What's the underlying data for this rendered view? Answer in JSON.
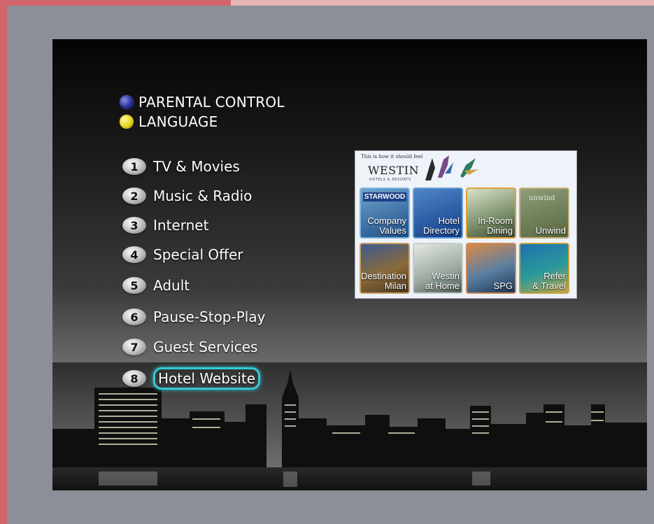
{
  "color_options": [
    {
      "label": "PARENTAL CONTROL",
      "color": "#2b2f9c",
      "icon": "blue-button-icon"
    },
    {
      "label": "LANGUAGE",
      "color": "#e6d21a",
      "icon": "yellow-button-icon"
    }
  ],
  "menu": [
    {
      "number": "1",
      "label": "TV & Movies"
    },
    {
      "number": "2",
      "label": "Music & Radio"
    },
    {
      "number": "3",
      "label": "Internet"
    },
    {
      "number": "4",
      "label": "Special Offer"
    },
    {
      "number": "5",
      "label": "Adult"
    },
    {
      "number": "6",
      "label": "Pause-Stop-Play"
    },
    {
      "number": "7",
      "label": "Guest Services"
    },
    {
      "number": "8",
      "label": "Hotel Website",
      "selected": true
    }
  ],
  "promo": {
    "tagline": "This is how it should feel",
    "logo": "WESTIN",
    "logo_sub": "HOTELS & RESORTS",
    "tiles": [
      {
        "brand": "STARWOOD",
        "label": "Company\nValues"
      },
      {
        "label": "Hotel\nDirectory"
      },
      {
        "label": "In-Room\nDining"
      },
      {
        "overlay": "unwind",
        "label": "Unwind"
      },
      {
        "label": "Destination\nMilan"
      },
      {
        "label": "Westin\nat Home"
      },
      {
        "label": "SPG"
      },
      {
        "label": "Refer\n& Travel"
      }
    ]
  },
  "colors": {
    "selection_highlight": "#34c8d6",
    "page_background": "#8c8f97",
    "accent_edge": "#d2646c"
  }
}
